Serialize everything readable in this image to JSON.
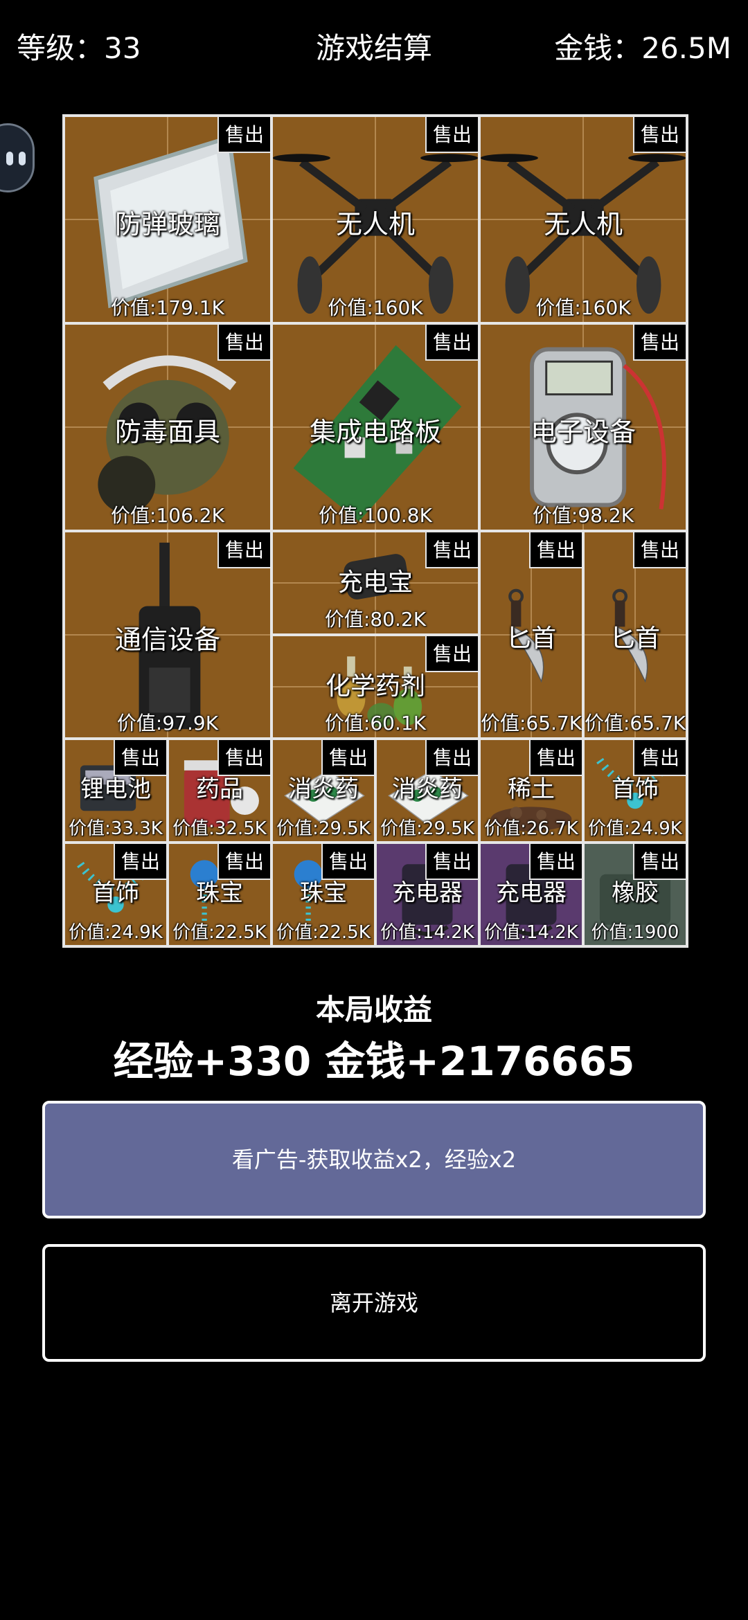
{
  "header": {
    "level": "等级：33",
    "title": "游戏结算",
    "money": "金钱：26.5M"
  },
  "sell_label": "售出",
  "items": [
    {
      "name": "防弹玻璃",
      "value": "价值:179.1K",
      "icon": "bulletproof-glass"
    },
    {
      "name": "无人机",
      "value": "价值:160K",
      "icon": "drone"
    },
    {
      "name": "无人机",
      "value": "价值:160K",
      "icon": "drone"
    },
    {
      "name": "防毒面具",
      "value": "价值:106.2K",
      "icon": "gas-mask"
    },
    {
      "name": "集成电路板",
      "value": "价值:100.8K",
      "icon": "circuit-board"
    },
    {
      "name": "电子设备",
      "value": "价值:98.2K",
      "icon": "electronic-device"
    },
    {
      "name": "通信设备",
      "value": "价值:97.9K",
      "icon": "walkie-talkie"
    },
    {
      "name": "充电宝",
      "value": "价值:80.2K",
      "icon": "power-bank"
    },
    {
      "name": "匕首",
      "value": "价值:65.7K",
      "icon": "dagger"
    },
    {
      "name": "匕首",
      "value": "价值:65.7K",
      "icon": "dagger"
    },
    {
      "name": "化学药剂",
      "value": "价值:60.1K",
      "icon": "chemical-flasks"
    },
    {
      "name": "锂电池",
      "value": "价值:33.3K",
      "icon": "lithium-battery"
    },
    {
      "name": "药品",
      "value": "价值:32.5K",
      "icon": "medicine"
    },
    {
      "name": "消炎药",
      "value": "价值:29.5K",
      "icon": "anti-inflammatory-pills"
    },
    {
      "name": "消炎药",
      "value": "价值:29.5K",
      "icon": "anti-inflammatory-pills"
    },
    {
      "name": "稀土",
      "value": "价值:26.7K",
      "icon": "rare-earth"
    },
    {
      "name": "首饰",
      "value": "价值:24.9K",
      "icon": "necklace"
    },
    {
      "name": "首饰",
      "value": "价值:24.9K",
      "icon": "necklace"
    },
    {
      "name": "珠宝",
      "value": "价值:22.5K",
      "icon": "gem-pendant"
    },
    {
      "name": "珠宝",
      "value": "价值:22.5K",
      "icon": "gem-pendant"
    },
    {
      "name": "充电器",
      "value": "价值:14.2K",
      "icon": "charger"
    },
    {
      "name": "充电器",
      "value": "价值:14.2K",
      "icon": "charger"
    },
    {
      "name": "橡胶",
      "value": "价值:1900",
      "icon": "rubber"
    }
  ],
  "summary": {
    "label": "本局收益",
    "value": "经验+330 金钱+2176665"
  },
  "buttons": {
    "ad": "看广告-获取收益x2，经验x2",
    "leave": "离开游戏"
  },
  "colors": {
    "cell_brown": "#8a5a1e",
    "cell_purple": "#5a3a6e",
    "cell_gray": "#4f5f55",
    "ad_button": "#636998"
  }
}
